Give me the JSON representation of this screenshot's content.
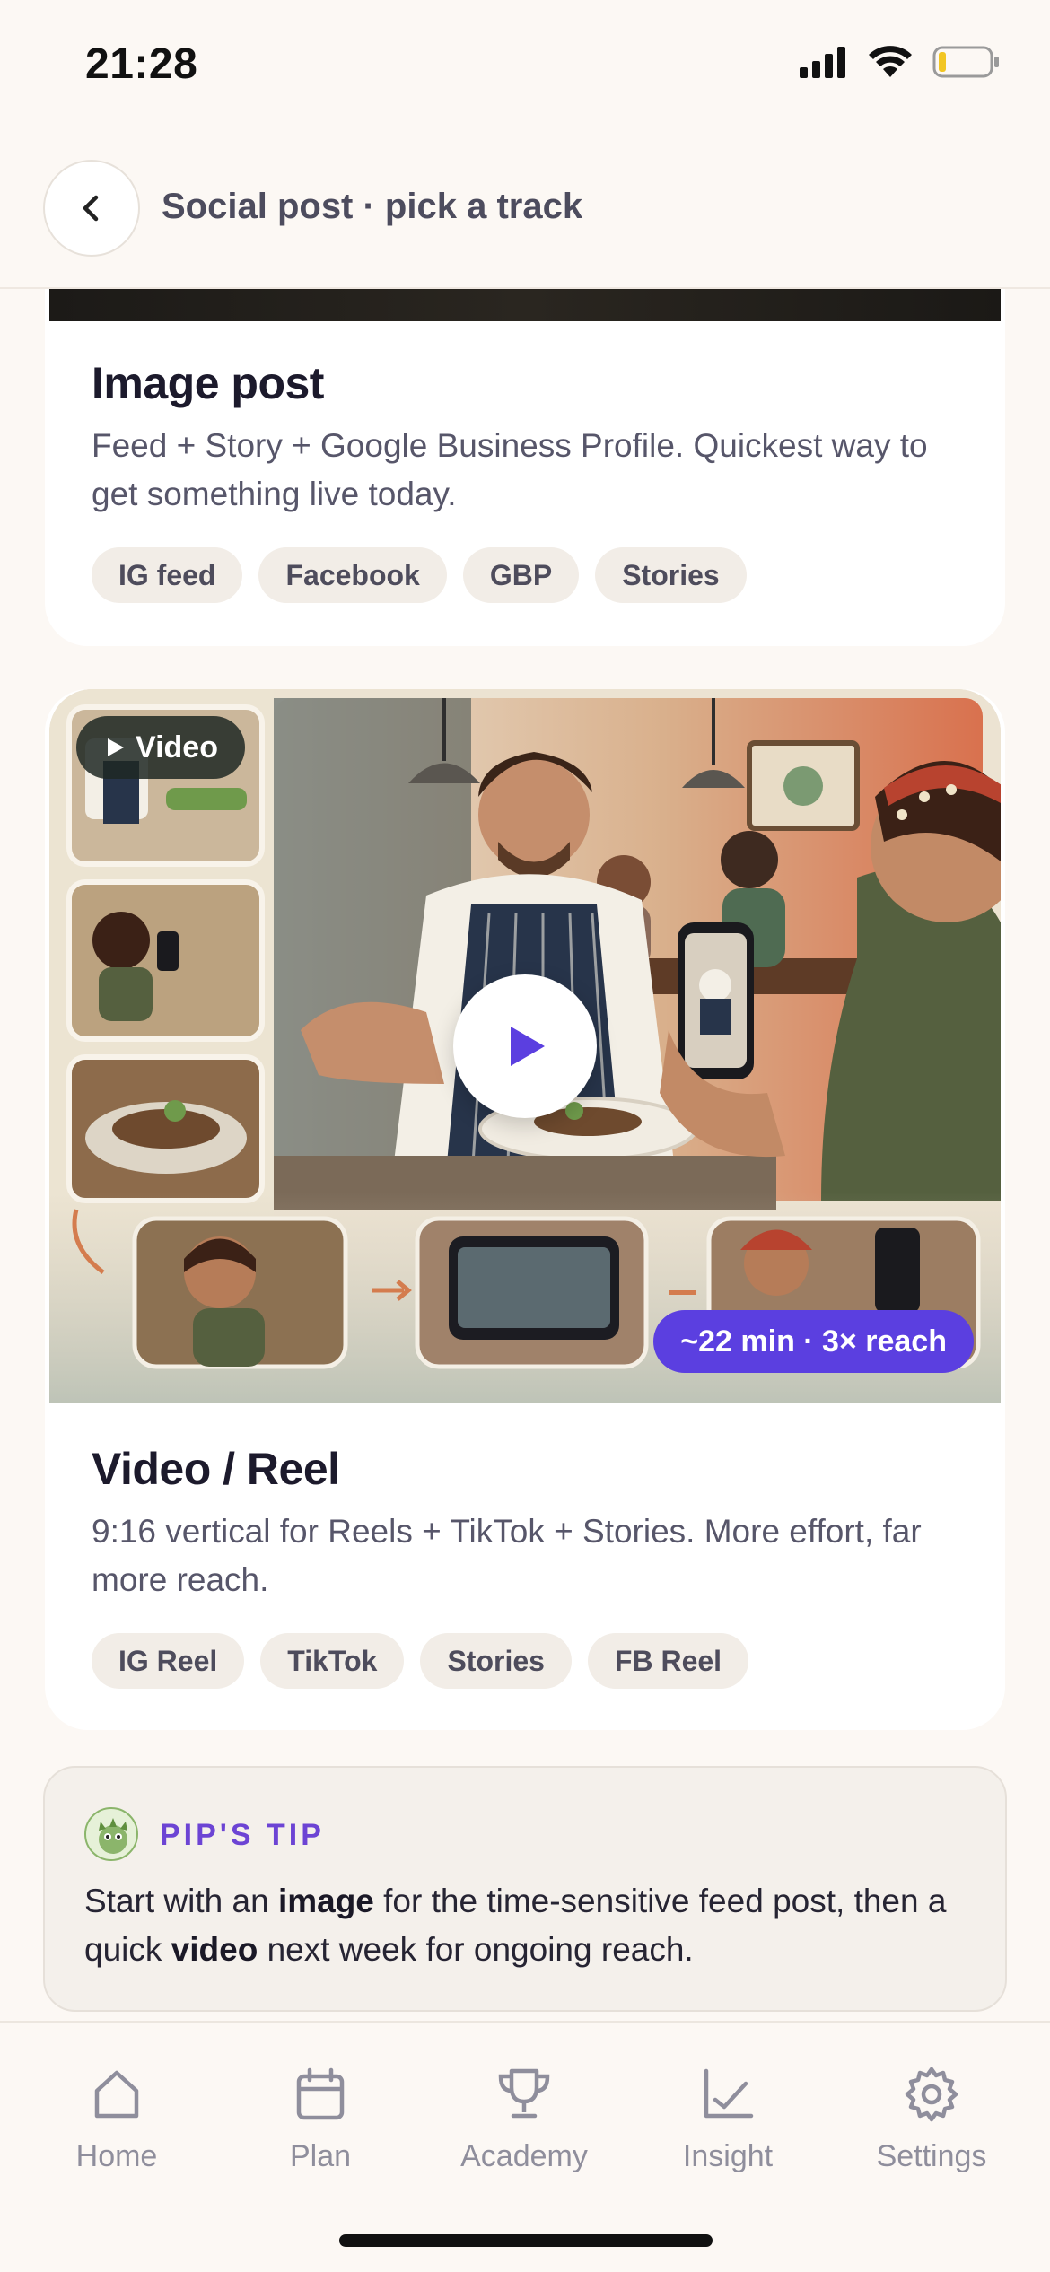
{
  "status_bar": {
    "time": "21:28",
    "icons": [
      "cellular-signal-icon",
      "wifi-icon",
      "battery-low-icon"
    ],
    "battery_level": 0.12
  },
  "header": {
    "back_icon": "chevron-left-icon",
    "title": "Social post · pick a track"
  },
  "cards": [
    {
      "title": "Image post",
      "description": "Feed + Story + Google Business Profile. Quickest way to get something live today.",
      "chips": [
        "IG feed",
        "Facebook",
        "GBP",
        "Stories"
      ]
    },
    {
      "badge": "Video",
      "badge_icon": "play-small-icon",
      "play_icon": "play-icon",
      "stat_badge": "~22 min · 3× reach",
      "title": "Video / Reel",
      "description": "9:16 vertical for Reels + TikTok + Stories. More effort, far more reach.",
      "chips": [
        "IG Reel",
        "TikTok",
        "Stories",
        "FB Reel"
      ]
    }
  ],
  "tip": {
    "label": "PIP'S TIP",
    "text_part1": "Start with an ",
    "bold1": "image",
    "text_part2": " for the time-sensitive feed post, then a quick ",
    "bold2": "video",
    "text_part3": " next week for ongoing reach."
  },
  "tabbar": {
    "items": [
      {
        "label": "Home",
        "icon": "home-icon"
      },
      {
        "label": "Plan",
        "icon": "calendar-icon"
      },
      {
        "label": "Academy",
        "icon": "trophy-icon"
      },
      {
        "label": "Insight",
        "icon": "chart-check-icon"
      },
      {
        "label": "Settings",
        "icon": "gear-icon"
      }
    ]
  },
  "colors": {
    "accent": "#5b3fe0",
    "tip_label": "#6c44d4",
    "background": "#fcf8f4",
    "chip_bg": "#f2ede7",
    "tab_inactive": "#8f8e9c"
  }
}
